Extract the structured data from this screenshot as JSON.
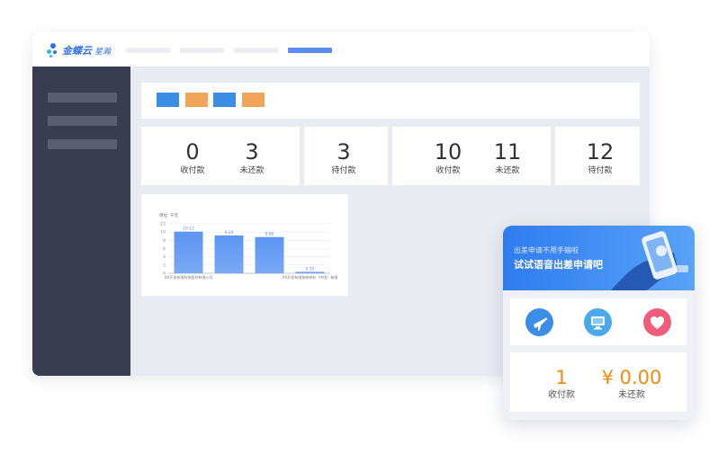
{
  "app": {
    "logo_text": "金蝶云",
    "logo_sub": "星瀚"
  },
  "colors": {
    "accent": "#3a8ee6",
    "orange": "#f3a45b",
    "nav_active": "#5b8def",
    "sidebar": "#383d4f",
    "amount": "#f28b0c"
  },
  "stats": [
    {
      "value": "0",
      "label": "收付款"
    },
    {
      "value": "3",
      "label": "未还款"
    },
    {
      "value": "3",
      "label": "待付款"
    },
    {
      "value": "10",
      "label": "收付款"
    },
    {
      "value": "11",
      "label": "未还款"
    },
    {
      "value": "12",
      "label": "待付款"
    }
  ],
  "chart_data": {
    "type": "bar",
    "ylabel": "单位: 千元",
    "ylim": [
      0,
      12
    ],
    "yticks": [
      "0",
      "2",
      "4",
      "6",
      "8",
      "10",
      "12"
    ],
    "categories": [
      "XX开发有限科技股份有限公司",
      "",
      "",
      "XX开发有限装修材料（中国）有限"
    ],
    "values": [
      10.12,
      9.2,
      8.8,
      0.35
    ],
    "value_labels": [
      "10.12",
      "9.20",
      "8.80",
      "0.35"
    ]
  },
  "card": {
    "banner_line1": "出差申请不用手输啦",
    "banner_line2": "试试语音出差申请吧",
    "icons": [
      "airplane-icon",
      "monitor-icon",
      "heart-icon"
    ],
    "stat1": {
      "value": "1",
      "label": "收付款"
    },
    "stat2": {
      "value": "¥ 0.00",
      "label": "未还款"
    }
  }
}
